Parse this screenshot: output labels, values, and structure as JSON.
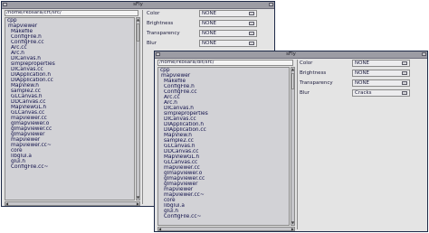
{
  "window1": {
    "title": "sFly",
    "path": "/home/rkosara/crt/src/",
    "files": [
      {
        "name": "cpp",
        "type": "top"
      },
      {
        "name": "mapviewer",
        "type": "dir"
      },
      {
        "name": "Makefile"
      },
      {
        "name": "ConfigFile.h"
      },
      {
        "name": "ConfigFile.cc"
      },
      {
        "name": "Arc.cc"
      },
      {
        "name": "Arc.h"
      },
      {
        "name": "DICanvas.h"
      },
      {
        "name": "simpleproperties"
      },
      {
        "name": "DICanvas.cc"
      },
      {
        "name": "DIApplication.h"
      },
      {
        "name": "DIApplication.cc"
      },
      {
        "name": "MapView.h"
      },
      {
        "name": "sample2.cc"
      },
      {
        "name": "GLCanvas.h"
      },
      {
        "name": "DDCanvas.cc"
      },
      {
        "name": "MapViewGL.h"
      },
      {
        "name": "GLCanvas.cc"
      },
      {
        "name": "mapviewer.cc"
      },
      {
        "name": "glmapviewer.o"
      },
      {
        "name": "glmapviewer.cc"
      },
      {
        "name": "glmapviewer"
      },
      {
        "name": "mapviewer"
      },
      {
        "name": "mapviewer.cc~"
      },
      {
        "name": "core"
      },
      {
        "name": "libglui.a"
      },
      {
        "name": "glui.h"
      },
      {
        "name": "ConfigFile.cc~"
      }
    ],
    "controls": [
      {
        "label": "Color",
        "value": "NONE"
      },
      {
        "label": "Brightness",
        "value": "NONE"
      },
      {
        "label": "Transparency",
        "value": "NONE"
      },
      {
        "label": "Blur",
        "value": "NONE"
      }
    ]
  },
  "window2": {
    "title": "sFly",
    "path": "/home/rkosara/dlt/src/",
    "files": [
      {
        "name": "cpp",
        "type": "top"
      },
      {
        "name": "mapviewer",
        "type": "dir"
      },
      {
        "name": "Makefile"
      },
      {
        "name": "ConfigFile.h"
      },
      {
        "name": "ConfigFile.cc"
      },
      {
        "name": "Arc.cc"
      },
      {
        "name": "Arc.h"
      },
      {
        "name": "DICanvas.h"
      },
      {
        "name": "simpleproperties"
      },
      {
        "name": "DICanvas.cc"
      },
      {
        "name": "DIApplication.h"
      },
      {
        "name": "DIApplication.cc"
      },
      {
        "name": "MapView.h"
      },
      {
        "name": "sample2.cc"
      },
      {
        "name": "GLCanvas.h"
      },
      {
        "name": "DDCanvas.cc"
      },
      {
        "name": "MapViewGL.h"
      },
      {
        "name": "GLCanvas.cc"
      },
      {
        "name": "mapviewer.cc"
      },
      {
        "name": "glmapviewer.o"
      },
      {
        "name": "glmapviewer.cc"
      },
      {
        "name": "glmapviewer"
      },
      {
        "name": "mapviewer"
      },
      {
        "name": "mapviewer.cc~"
      },
      {
        "name": "core"
      },
      {
        "name": "libglui.a"
      },
      {
        "name": "glui.h"
      },
      {
        "name": "ConfigFile.cc~"
      }
    ],
    "controls": [
      {
        "label": "Color",
        "value": "NONE"
      },
      {
        "label": "Brightness",
        "value": "NONE"
      },
      {
        "label": "Transparency",
        "value": "NONE"
      },
      {
        "label": "Blur",
        "value": "Cracks"
      }
    ]
  }
}
